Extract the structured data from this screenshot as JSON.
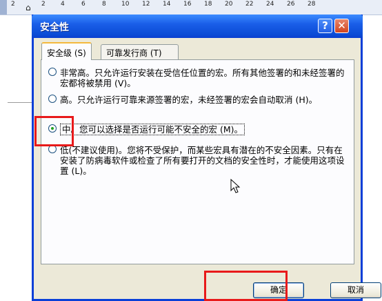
{
  "ruler": {
    "numbers": [
      "2",
      "2",
      "4",
      "6",
      "8",
      "10",
      "12",
      "14",
      "16",
      "18",
      "20",
      "22",
      "24",
      "26",
      "28"
    ]
  },
  "dialog": {
    "title": "安全性",
    "help_label": "?",
    "close_label": "✕"
  },
  "tabs": [
    {
      "label": "安全级 (S)",
      "selected": true
    },
    {
      "label": "可靠发行商 (T)",
      "selected": false
    }
  ],
  "options": [
    {
      "label": "非常高。只允许运行安装在受信任位置的宏。所有其他签署的和未经签署的宏都将被禁用 (V)。",
      "checked": false
    },
    {
      "label": "高。只允许运行可靠来源签署的宏，未经签署的宏会自动取消 (H)。",
      "checked": false
    },
    {
      "label": "中。您可以选择是否运行可能不安全的宏 (M)。",
      "checked": true
    },
    {
      "label": "低(不建议使用)。您将不受保护，而某些宏具有潜在的不安全因素。只有在安装了防病毒软件或检查了所有要打开的文档的安全性时，才能使用这项设置 (L)。",
      "checked": false
    }
  ],
  "buttons": {
    "ok": "确定",
    "cancel": "取消"
  },
  "icons": {
    "cursor": "mouse-pointer-icon",
    "help": "help-icon",
    "close": "close-icon"
  },
  "colors": {
    "title_bar": "#0b4cd6",
    "highlight": "#e8191a",
    "dialog_bg": "#ece9d8"
  }
}
